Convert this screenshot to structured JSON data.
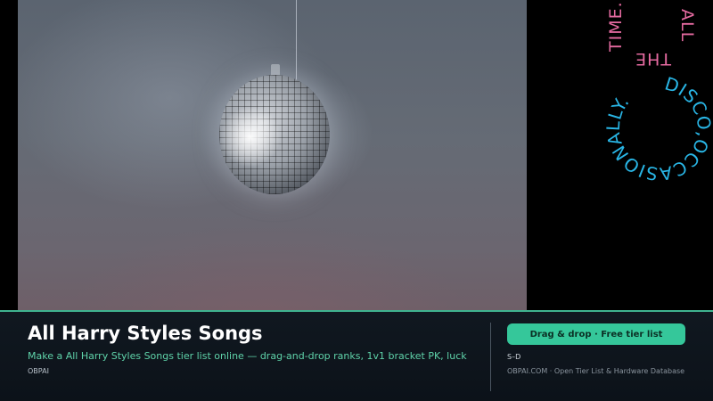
{
  "hero": {
    "photo_subject": "disco ball",
    "art_words": [
      "TIME.",
      "ALL",
      "THE"
    ],
    "ring_text": "DISCO,OCCASIONALLY.",
    "colors": {
      "pink": "#e56aa0",
      "blue": "#29b6e6"
    }
  },
  "footer": {
    "title": "All Harry Styles Songs",
    "description": "Make a All Harry Styles Songs tier list online — drag-and-drop ranks, 1v1 bracket PK, luck",
    "brand": "OBPAI",
    "cta_label": "Drag & drop · Free tier list",
    "tiers": "S–D",
    "site": "OBPAI.COM · Open Tier List & Hardware Database",
    "accent_color": "#35c79a"
  }
}
